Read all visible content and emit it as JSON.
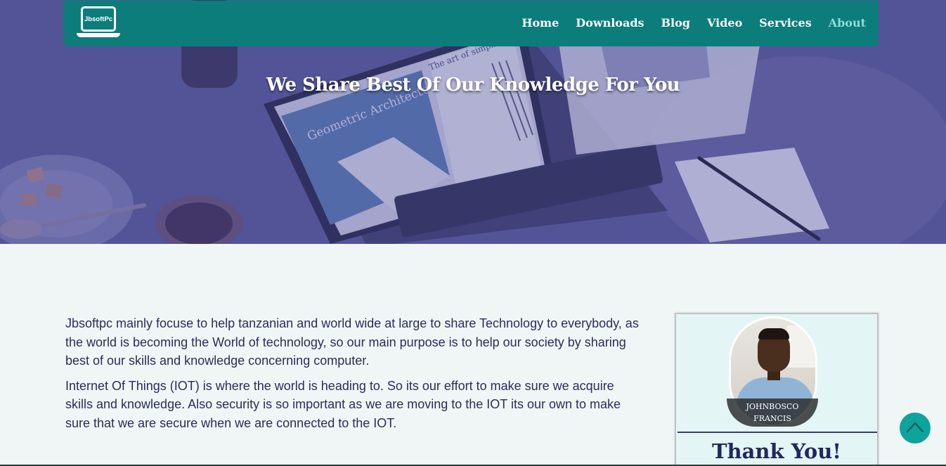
{
  "brand": {
    "logo_text": "JbsoftPc"
  },
  "nav": {
    "items": [
      {
        "label": "Home",
        "active": false
      },
      {
        "label": "Downloads",
        "active": false
      },
      {
        "label": "Blog",
        "active": false
      },
      {
        "label": "Video",
        "active": false
      },
      {
        "label": "Services",
        "active": false
      },
      {
        "label": "About",
        "active": true
      }
    ]
  },
  "hero": {
    "title": "We Share Best Of Our Knowledge For You",
    "image_text": {
      "slide_title": "Geometric Architecture",
      "page_heading": "The art of simplicity"
    }
  },
  "content": {
    "paragraphs": [
      "Jbsoftpc mainly focuse to help tanzanian and world wide at large to share Technology to everybody, as the world is becoming the World of technology, so our main purpose is to help our society by sharing best of our skills and knowledge concerning computer.",
      "Internet Of Things (IOT) is where the world is heading to. So its our effort to make sure we acquire skills and knowledge. Also security is so important as we are moving to the IOT its our own to make sure that we are secure when we are connected to the IOT."
    ]
  },
  "profile": {
    "name_line1": "JOHNBOSCO",
    "name_line2": "FRANCIS",
    "thank_you": "Thank You!"
  },
  "colors": {
    "nav_bg": "#0c7d7b",
    "nav_active": "#8fdcd3",
    "hero_overlay": "#4e4f8c",
    "text": "#2a2d5c",
    "scroll_button": "#0ea39c"
  },
  "icons": {
    "scroll_top": "chevron-up-icon"
  }
}
